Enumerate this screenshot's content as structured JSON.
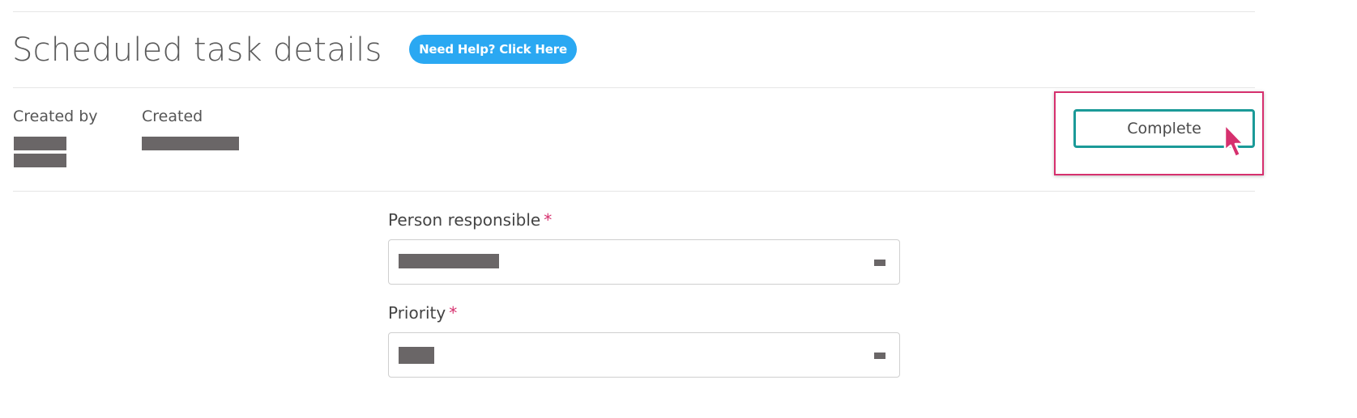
{
  "header": {
    "title": "Scheduled task details",
    "help_button_label": "Need Help? Click Here"
  },
  "meta": {
    "created_by_label": "Created by",
    "created_label": "Created"
  },
  "actions": {
    "complete_label": "Complete"
  },
  "form": {
    "person_responsible": {
      "label": "Person responsible",
      "required_mark": "*"
    },
    "priority": {
      "label": "Priority",
      "required_mark": "*"
    }
  },
  "colors": {
    "help_button": "#2aa8f2",
    "complete_border": "#1b9a98",
    "highlight": "#d6306e",
    "required": "#d6306e",
    "redaction": "#6a6667"
  },
  "icons": {
    "cursor": "mouse-pointer-icon",
    "dropdown": "dropdown-indicator-icon"
  }
}
